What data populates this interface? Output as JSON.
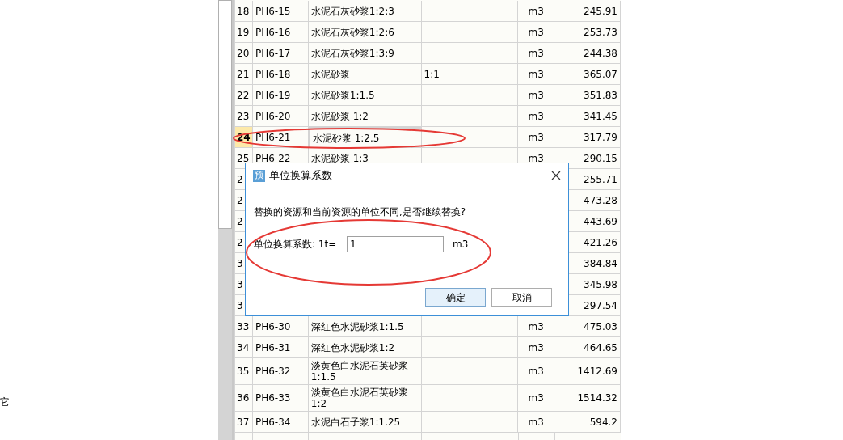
{
  "side_text": "它",
  "table": {
    "rows": [
      {
        "number": "18",
        "code": "PH6-15",
        "name": "水泥石灰砂浆1:2:3",
        "unit": "m3",
        "price": "245.91",
        "selected": false
      },
      {
        "number": "19",
        "code": "PH6-16",
        "name": "水泥石灰砂浆1:2:6",
        "unit": "m3",
        "price": "253.73",
        "selected": false
      },
      {
        "number": "20",
        "code": "PH6-17",
        "name": "水泥石灰砂浆1:3:9",
        "unit": "m3",
        "price": "244.38",
        "selected": false
      },
      {
        "number": "21",
        "code": "PH6-18",
        "name": "水泥砂浆",
        "spec": "1:1",
        "unit": "m3",
        "price": "365.07",
        "selected": false
      },
      {
        "number": "22",
        "code": "PH6-19",
        "name": "水泥砂浆1:1.5",
        "unit": "m3",
        "price": "351.83",
        "selected": false
      },
      {
        "number": "23",
        "code": "PH6-20",
        "name": "水泥砂浆 1:2",
        "unit": "m3",
        "price": "341.45",
        "selected": false
      },
      {
        "number": "24",
        "code": "PH6-21",
        "name": "水泥砂浆 1:2.5",
        "unit": "m3",
        "price": "317.79",
        "selected": true
      },
      {
        "number": "25",
        "code": "PH6-22",
        "name": "水泥砂浆 1:3",
        "unit": "m3",
        "price": "290.15",
        "selected": false
      },
      {
        "number": "2",
        "price": "255.71",
        "selected": false
      },
      {
        "number": "2",
        "price": "473.28",
        "selected": false
      },
      {
        "number": "2",
        "price": "443.69",
        "selected": false
      },
      {
        "number": "2",
        "price": "421.26",
        "selected": false
      },
      {
        "number": "3",
        "price": "384.84",
        "selected": false
      },
      {
        "number": "3",
        "price": "345.98",
        "selected": false
      },
      {
        "number": "3",
        "price": "297.54",
        "selected": false
      },
      {
        "number": "33",
        "code": "PH6-30",
        "name": "深红色水泥砂浆1:1.5",
        "unit": "m3",
        "price": "475.03",
        "selected": false
      },
      {
        "number": "34",
        "code": "PH6-31",
        "name": "深红色水泥砂浆1:2",
        "unit": "m3",
        "price": "464.65",
        "selected": false
      },
      {
        "number": "35",
        "code": "PH6-32",
        "name": "淡黄色白水泥石英砂浆1:1.5",
        "unit": "m3",
        "price": "1412.69",
        "selected": false
      },
      {
        "number": "36",
        "code": "PH6-33",
        "name": "淡黄色白水泥石英砂浆1:2",
        "unit": "m3",
        "price": "1514.32",
        "selected": false
      },
      {
        "number": "37",
        "code": "PH6-34",
        "name": "水泥白石子浆1:1.25",
        "unit": "m3",
        "price": "594.2",
        "selected": false
      }
    ]
  },
  "dialog": {
    "icon_text": "预",
    "title": "单位换算系数",
    "message": "替换的资源和当前资源的单位不同,是否继续替换?",
    "field_label": "单位换算系数: 1t=",
    "field_value": "1",
    "field_unit": "m3",
    "buttons": [
      {
        "label": "确定",
        "selected": true
      },
      {
        "label": "取消",
        "selected": false
      }
    ]
  }
}
